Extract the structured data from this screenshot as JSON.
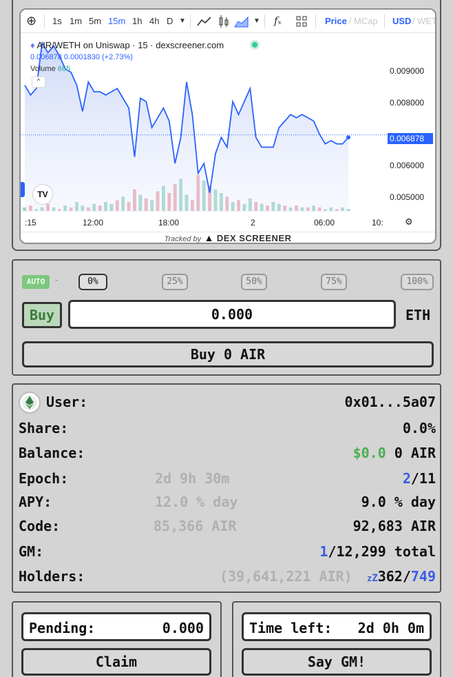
{
  "toolbar": {
    "intervals": [
      "1s",
      "1m",
      "5m",
      "15m",
      "1h",
      "4h",
      "D"
    ],
    "active_interval": "15m",
    "fx": "fₓ",
    "price_label": "Price",
    "mcap_label": "MCap",
    "usd_label": "USD",
    "weth_label": "WETH"
  },
  "legend": {
    "title": "AIR/WETH on Uniswap · 15 · dexscreener.com",
    "ohlc": "0.006878 0.0001830 (+2.73%)",
    "volume_label": "Volume",
    "volume_value": "665"
  },
  "chart_data": {
    "type": "line",
    "title": "AIR/WETH on Uniswap · 15 · dexscreener.com",
    "xlabel": "",
    "ylabel": "",
    "x_ticks": [
      ":15",
      "12:00",
      "18:00",
      "2",
      "06:00",
      "10:"
    ],
    "y_ticks": [
      "0.009000",
      "0.008000",
      "0.006000",
      "0.005000"
    ],
    "ylim": [
      0.0045,
      0.01
    ],
    "current_price": "0.006878",
    "line_color": "#2962ff",
    "values": [
      0.0084,
      0.0081,
      0.0083,
      0.0097,
      0.0094,
      0.0096,
      0.0093,
      0.0089,
      0.0088,
      0.0084,
      0.0076,
      0.0085,
      0.0082,
      0.0082,
      0.0081,
      0.0082,
      0.0083,
      0.008,
      0.0077,
      0.0062,
      0.008,
      0.0079,
      0.0071,
      0.0074,
      0.0077,
      0.0073,
      0.006,
      0.0068,
      0.0085,
      0.0075,
      0.0057,
      0.006,
      0.0051,
      0.0063,
      0.0068,
      0.0065,
      0.0079,
      0.0075,
      0.0079,
      0.0083,
      0.0068,
      0.0065,
      0.0065,
      0.0065,
      0.0071,
      0.0073,
      0.0075,
      0.0074,
      0.0075,
      0.0074,
      0.0073,
      0.0069,
      0.0066,
      0.0067,
      0.0066,
      0.0066,
      0.0068
    ],
    "volume_values": [
      2,
      3,
      1,
      2,
      4,
      2,
      1,
      3,
      2,
      5,
      3,
      2,
      4,
      3,
      5,
      4,
      6,
      8,
      5,
      12,
      9,
      7,
      6,
      11,
      14,
      10,
      15,
      18,
      9,
      6,
      20,
      17,
      14,
      12,
      10,
      8,
      5,
      6,
      4,
      7,
      5,
      4,
      3,
      5,
      4,
      3,
      2,
      3,
      2,
      2,
      3,
      2,
      1,
      2,
      1,
      2,
      1
    ],
    "volume_up": [
      true,
      false,
      true,
      true,
      false,
      true,
      false,
      true,
      false,
      true,
      true,
      false,
      true,
      false,
      true,
      true,
      false,
      true,
      false,
      false,
      true,
      false,
      true,
      false,
      true,
      false,
      false,
      true,
      true,
      false,
      false,
      true,
      false,
      true,
      true,
      false,
      true,
      false,
      true,
      true,
      false,
      true,
      false,
      true,
      true,
      false,
      true,
      false,
      true,
      false,
      true,
      false,
      true,
      true,
      false,
      true,
      true
    ]
  },
  "tracked_by": {
    "prefix": "Tracked by",
    "brand": "DEX SCREENER"
  },
  "buy_panel": {
    "auto_label": "AUTO",
    "auto_dash": "-",
    "percent_options": [
      "0%",
      "25%",
      "50%",
      "75%",
      "100%"
    ],
    "selected_percent": "0%",
    "mode_label": "Buy",
    "amount_value": "0.000",
    "currency": "ETH",
    "action_label": "Buy 0 AIR"
  },
  "stats": {
    "user_label": "User:",
    "user_value": "0x01...5a07",
    "share_label": "Share:",
    "share_value": "0.0%",
    "balance_label": "Balance:",
    "balance_usd": "$0.0",
    "balance_air": "0 AIR",
    "epoch_label": "Epoch:",
    "epoch_time": "2d 9h 30m",
    "epoch_current": "2",
    "epoch_total": "/11",
    "apy_label": "APY:",
    "apy_mid": "12.0 % day",
    "apy_value": "9.0 % day",
    "code_label": "Code:",
    "code_mid": "85,366 AIR",
    "code_value": "92,683 AIR",
    "gm_label": "GM:",
    "gm_count": "1",
    "gm_total": "/12,299 total",
    "holders_label": "Holders:",
    "holders_mid": "(39,641,221 AIR)",
    "holders_zz": "z",
    "holders_zz2": "Z",
    "holders_active": "362",
    "holders_sep": "/",
    "holders_total": "749"
  },
  "pending": {
    "label": "Pending:",
    "value": "0.000",
    "action": "Claim"
  },
  "timer": {
    "label": "Time left:",
    "value": "2d 0h 0m",
    "action": "Say GM!"
  }
}
